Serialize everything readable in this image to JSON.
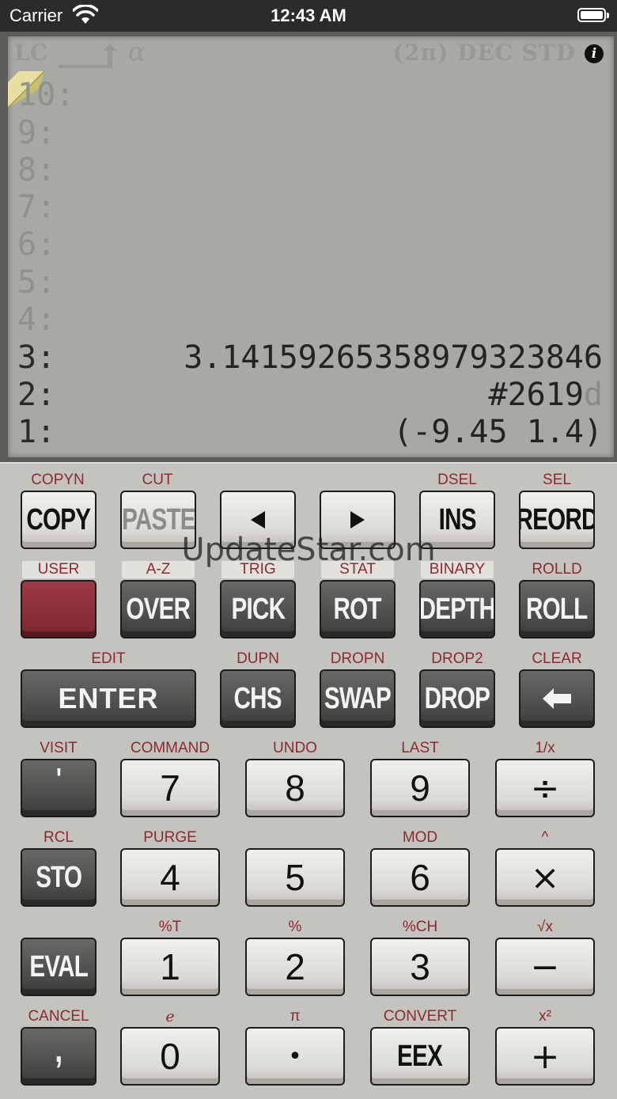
{
  "status_bar": {
    "carrier": "Carrier",
    "time": "12:43 AM"
  },
  "annunciators": {
    "lc": "LC",
    "alpha": "α",
    "modes": "(2π) DEC STD",
    "info": "i"
  },
  "stack": [
    {
      "level": "10:",
      "value": ""
    },
    {
      "level": "9:",
      "value": ""
    },
    {
      "level": "8:",
      "value": ""
    },
    {
      "level": "7:",
      "value": ""
    },
    {
      "level": "6:",
      "value": ""
    },
    {
      "level": "5:",
      "value": ""
    },
    {
      "level": "4:",
      "value": ""
    },
    {
      "level": "3:",
      "value": "3.14159265358979323846"
    },
    {
      "level": "2:",
      "value": "#2619",
      "suffix": "d"
    },
    {
      "level": "1:",
      "value": "(-9.45 1.4)"
    }
  ],
  "watermark": "UpdateStar.com",
  "keys": {
    "copy": {
      "label": "COPY",
      "shift": "COPYN"
    },
    "paste": {
      "label": "PASTE",
      "shift": "CUT"
    },
    "left": {
      "label": ""
    },
    "right": {
      "label": ""
    },
    "ins": {
      "label": "INS",
      "shift": "DSEL"
    },
    "reord": {
      "label": "REORD",
      "shift": "SEL"
    },
    "user": {
      "label": "",
      "shift": "USER"
    },
    "over": {
      "label": "OVER",
      "shift": "A-Z"
    },
    "pick": {
      "label": "PICK",
      "shift": "TRIG"
    },
    "rot": {
      "label": "ROT",
      "shift": "STAT"
    },
    "depth": {
      "label": "DEPTH",
      "shift": "BINARY"
    },
    "roll": {
      "label": "ROLL",
      "shift": "ROLLD"
    },
    "enter": {
      "label": "ENTER",
      "shift": "EDIT"
    },
    "chs": {
      "label": "CHS",
      "shift": "DUPN"
    },
    "swap": {
      "label": "SWAP",
      "shift": "DROPN"
    },
    "drop": {
      "label": "DROP",
      "shift": "DROP2"
    },
    "backspace": {
      "label": "",
      "shift": "CLEAR"
    },
    "quote": {
      "label": "'",
      "shift": "VISIT"
    },
    "seven": {
      "label": "7",
      "shift": "COMMAND"
    },
    "eight": {
      "label": "8",
      "shift": "UNDO"
    },
    "nine": {
      "label": "9",
      "shift": "LAST"
    },
    "divide": {
      "label": "÷",
      "shift": "1/x"
    },
    "sto": {
      "label": "STO",
      "shift": "RCL"
    },
    "four": {
      "label": "4",
      "shift": "PURGE"
    },
    "five": {
      "label": "5",
      "shift": ""
    },
    "six": {
      "label": "6",
      "shift": "MOD"
    },
    "multiply": {
      "label": "×",
      "shift": "^"
    },
    "eval": {
      "label": "EVAL",
      "shift": ""
    },
    "one": {
      "label": "1",
      "shift": "%T"
    },
    "two": {
      "label": "2",
      "shift": "%"
    },
    "three": {
      "label": "3",
      "shift": "%CH"
    },
    "minus": {
      "label": "−",
      "shift": "√x"
    },
    "comma": {
      "label": ",",
      "shift": "CANCEL"
    },
    "zero": {
      "label": "0",
      "shift": "e"
    },
    "dot": {
      "label": "•",
      "shift": "π"
    },
    "eex": {
      "label": "EEX",
      "shift": "CONVERT"
    },
    "plus": {
      "label": "+",
      "shift": "x²"
    }
  }
}
